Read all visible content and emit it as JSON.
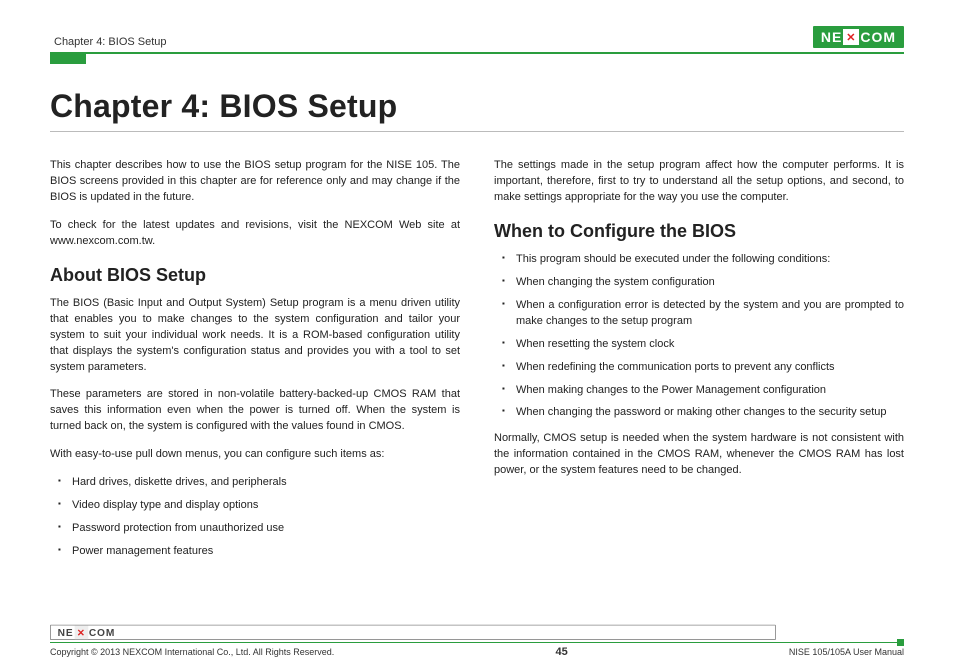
{
  "header": {
    "breadcrumb": "Chapter 4: BIOS Setup",
    "brand": "NEXCOM"
  },
  "title": "Chapter 4: BIOS Setup",
  "left_column": {
    "intro_p1": "This chapter describes how to use the BIOS setup program for the NISE 105. The BIOS screens provided in this chapter are for reference only and may change if the BIOS is updated in the future.",
    "intro_p2": "To check for the latest updates and revisions, visit the NEXCOM Web site at www.nexcom.com.tw.",
    "section_heading": "About BIOS Setup",
    "about_p1": "The BIOS (Basic Input and Output System) Setup program is a menu driven utility that enables you to make changes to the system configuration and tailor your system to suit your individual work needs. It is a ROM-based configuration utility that displays the system's configuration status and provides you with a tool to set system parameters.",
    "about_p2": "These parameters are stored in non-volatile battery-backed-up CMOS RAM that saves this information even when the power is turned off. When the system is turned back on, the system is configured with the values found in CMOS.",
    "about_p3": "With easy-to-use pull down menus, you can configure such items as:",
    "config_items": [
      "Hard drives, diskette drives, and peripherals",
      "Video display type and display options",
      "Password protection from unauthorized use",
      "Power management features"
    ]
  },
  "right_column": {
    "top_p": "The settings made in the setup program affect how the computer performs. It is important, therefore, first to try to understand all the setup options, and second, to make settings appropriate for the way you use the computer.",
    "section_heading": "When to Configure the BIOS",
    "when_items": [
      "This program should be executed under the following conditions:",
      "When changing the system configuration",
      "When a configuration error is detected by the system and you are prompted to make changes to the setup program",
      "When resetting the system clock",
      "When redefining the communication ports to prevent any conflicts",
      "When making changes to the Power Management configuration",
      "When changing the password or making other changes to the security setup"
    ],
    "closing_p": "Normally, CMOS setup is needed when the system hardware is not consistent with the information contained in the CMOS RAM, whenever the CMOS RAM has lost power, or the system features need to be changed."
  },
  "footer": {
    "copyright": "Copyright © 2013 NEXCOM International Co., Ltd. All Rights Reserved.",
    "page": "45",
    "doc": "NISE 105/105A User Manual"
  }
}
